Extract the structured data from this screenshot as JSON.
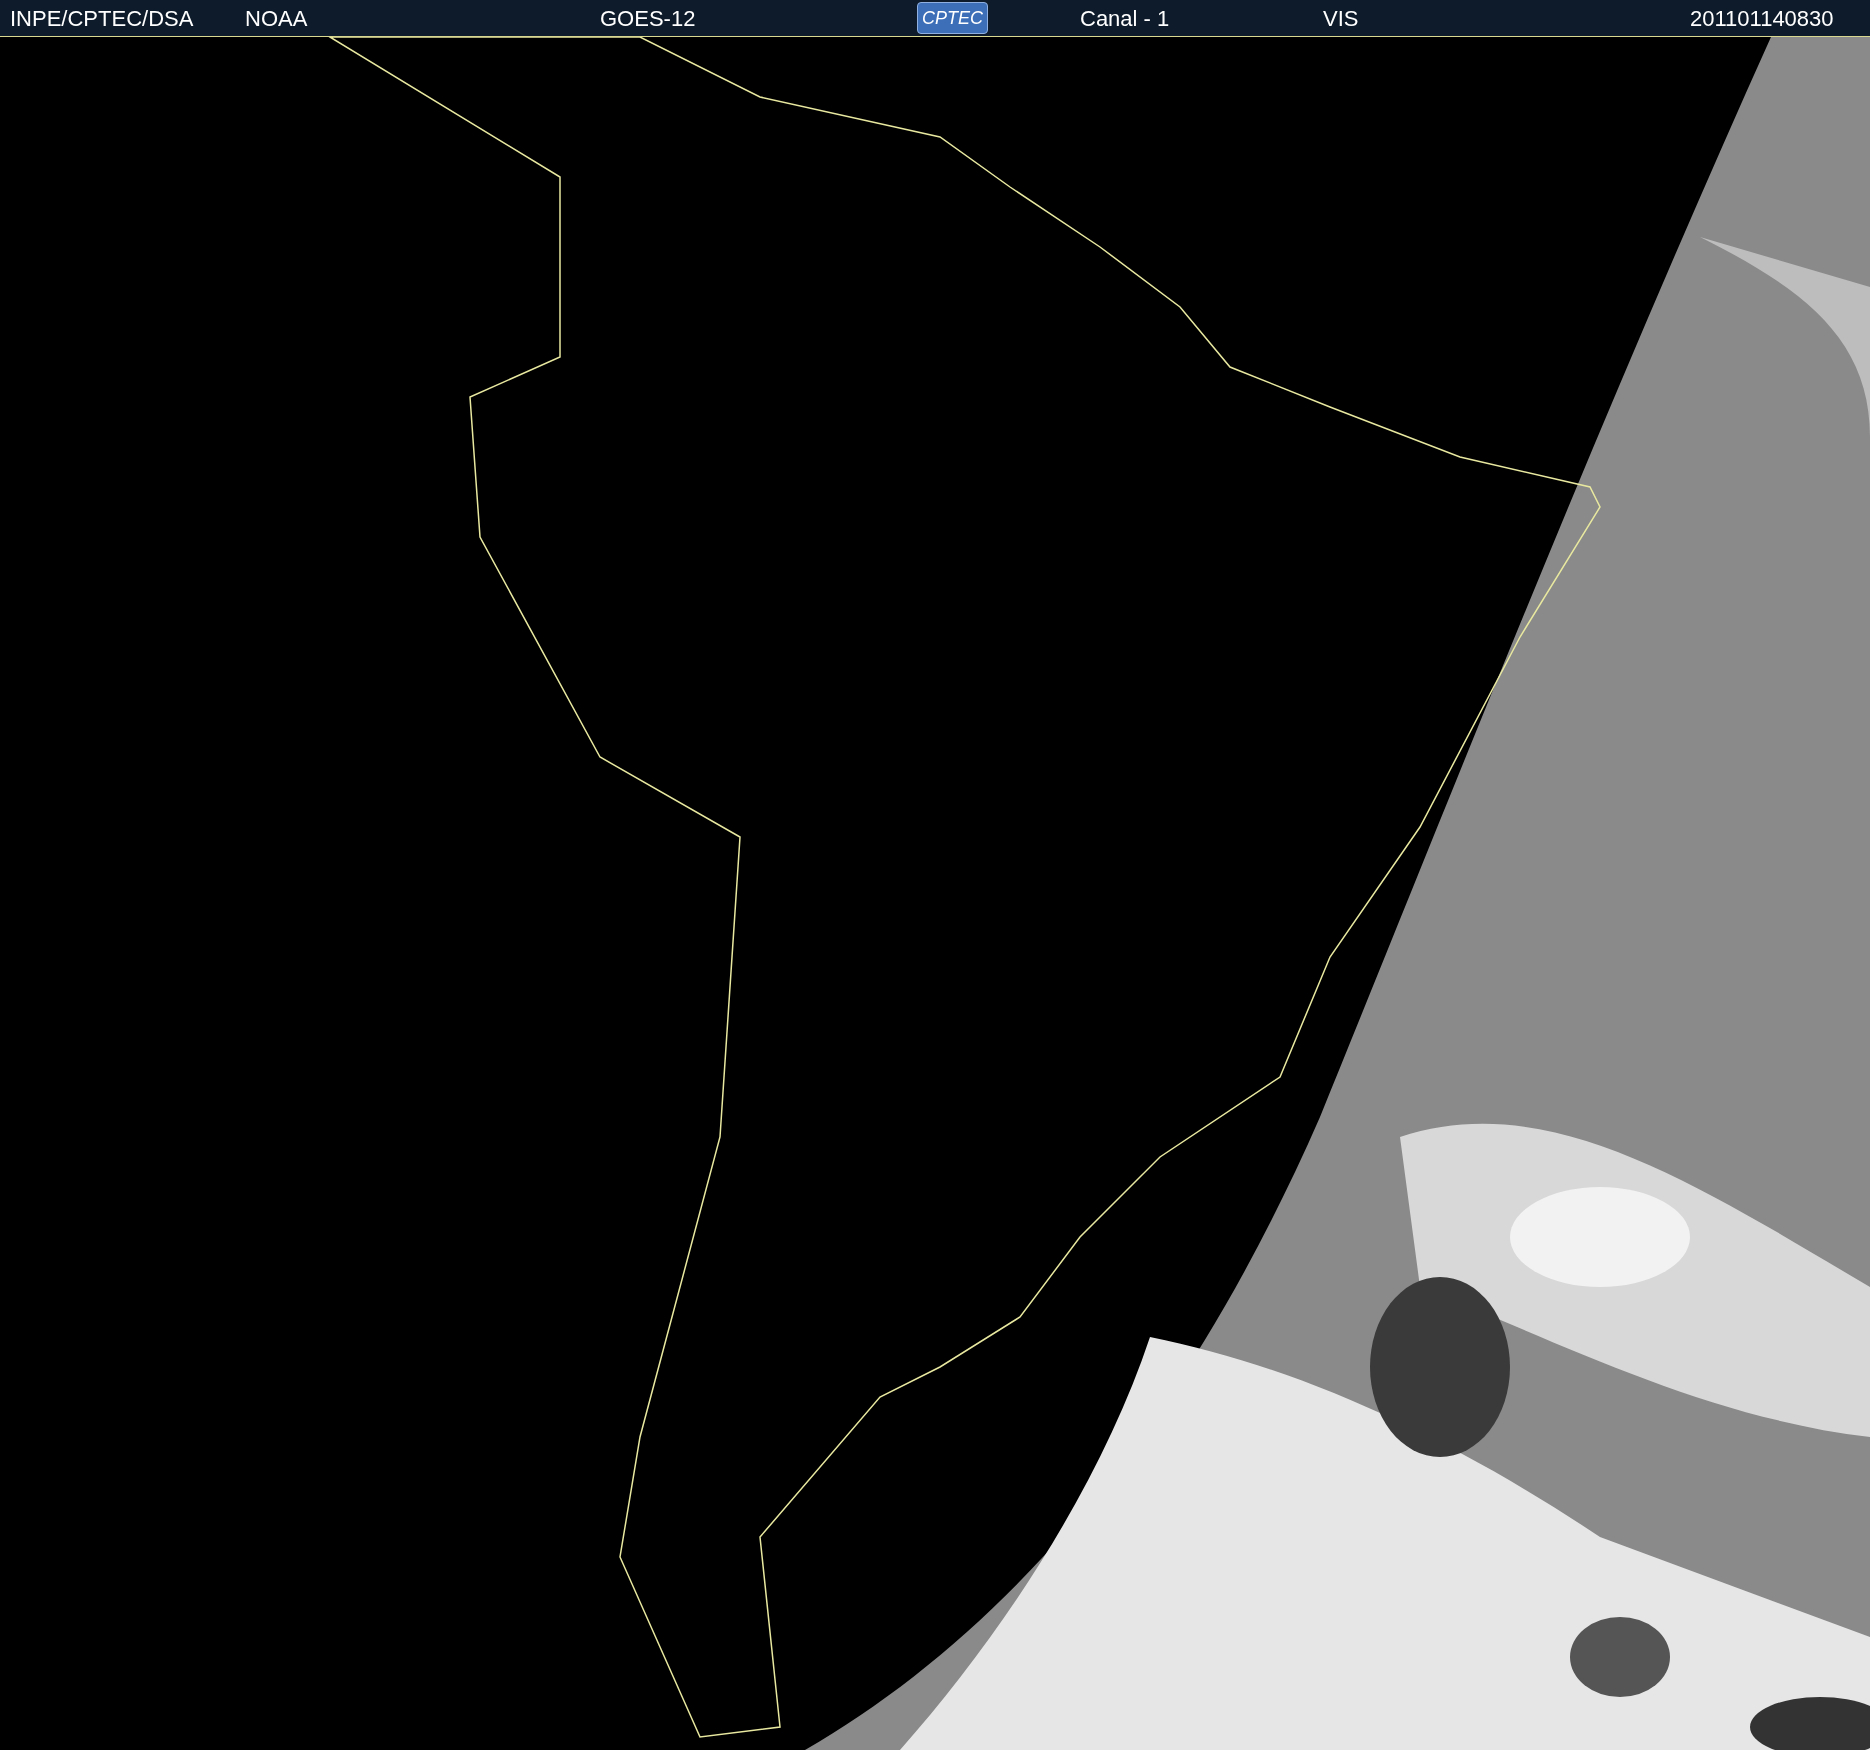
{
  "header": {
    "items": [
      {
        "kind": "text",
        "text": "INPE/CPTEC/DSA"
      },
      {
        "kind": "text",
        "text": "NOAA"
      },
      {
        "kind": "text",
        "text": "GOES-12"
      },
      {
        "kind": "logo",
        "text": "CPTEC"
      },
      {
        "kind": "text",
        "text": "Canal - 1"
      },
      {
        "kind": "text",
        "text": "VIS"
      },
      {
        "kind": "text",
        "text": "201101140830"
      }
    ]
  }
}
